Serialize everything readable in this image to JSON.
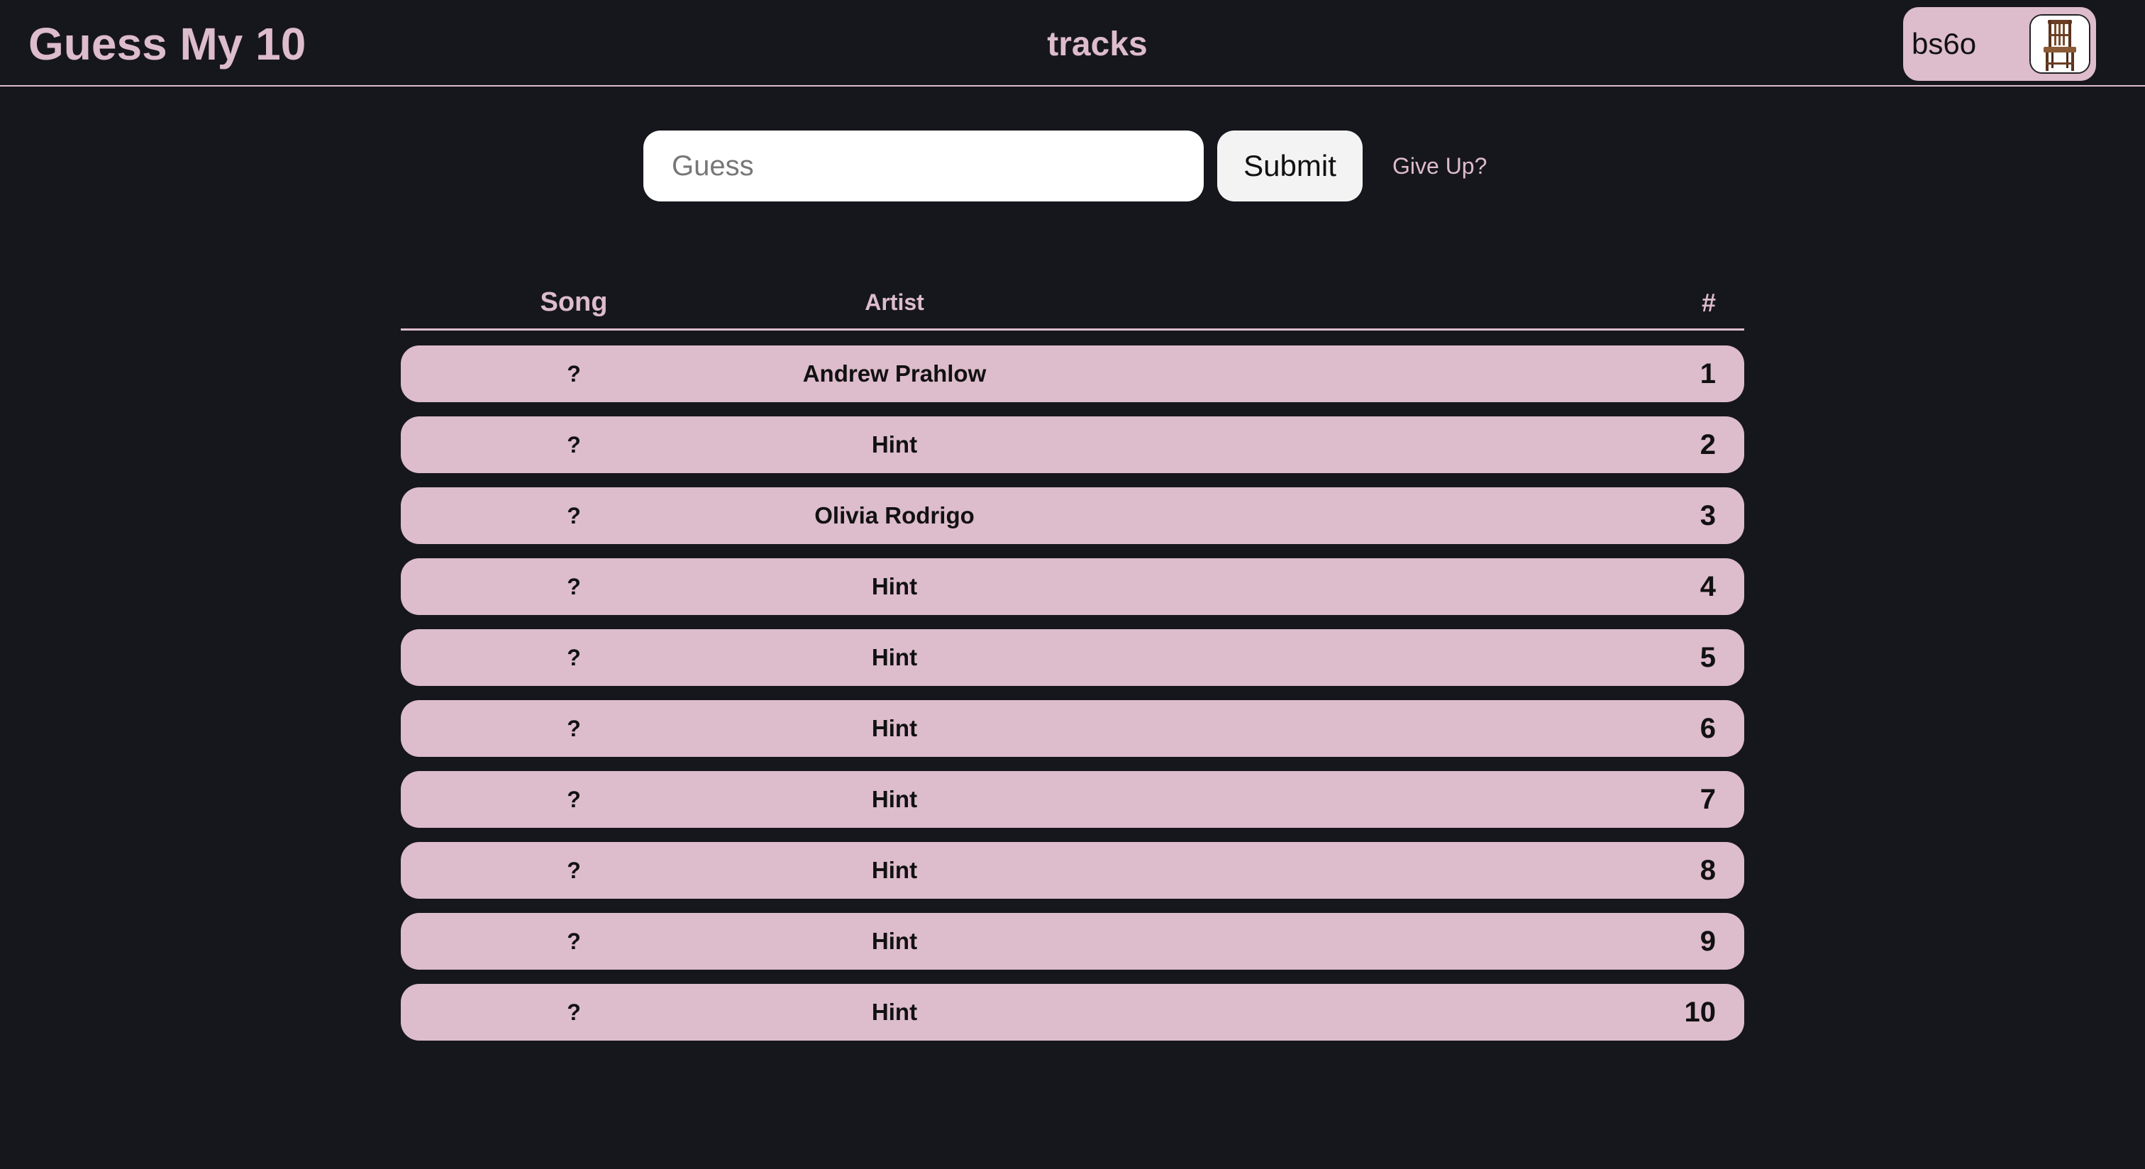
{
  "app": {
    "title": "Guess My 10",
    "mode": "tracks"
  },
  "user": {
    "name": "bs6o",
    "avatar_icon": "chair-icon"
  },
  "guess_form": {
    "placeholder": "Guess",
    "value": "",
    "submit_label": "Submit",
    "give_up_label": "Give Up?"
  },
  "table": {
    "headers": {
      "song": "Song",
      "artist": "Artist",
      "number": "#"
    },
    "rows": [
      {
        "song": "?",
        "artist": "Andrew Prahlow",
        "number": "1"
      },
      {
        "song": "?",
        "artist": "Hint",
        "number": "2"
      },
      {
        "song": "?",
        "artist": "Olivia Rodrigo",
        "number": "3"
      },
      {
        "song": "?",
        "artist": "Hint",
        "number": "4"
      },
      {
        "song": "?",
        "artist": "Hint",
        "number": "5"
      },
      {
        "song": "?",
        "artist": "Hint",
        "number": "6"
      },
      {
        "song": "?",
        "artist": "Hint",
        "number": "7"
      },
      {
        "song": "?",
        "artist": "Hint",
        "number": "8"
      },
      {
        "song": "?",
        "artist": "Hint",
        "number": "9"
      },
      {
        "song": "?",
        "artist": "Hint",
        "number": "10"
      }
    ]
  },
  "colors": {
    "background": "#16171c",
    "accent": "#ddbccb",
    "row_text": "#111111"
  }
}
